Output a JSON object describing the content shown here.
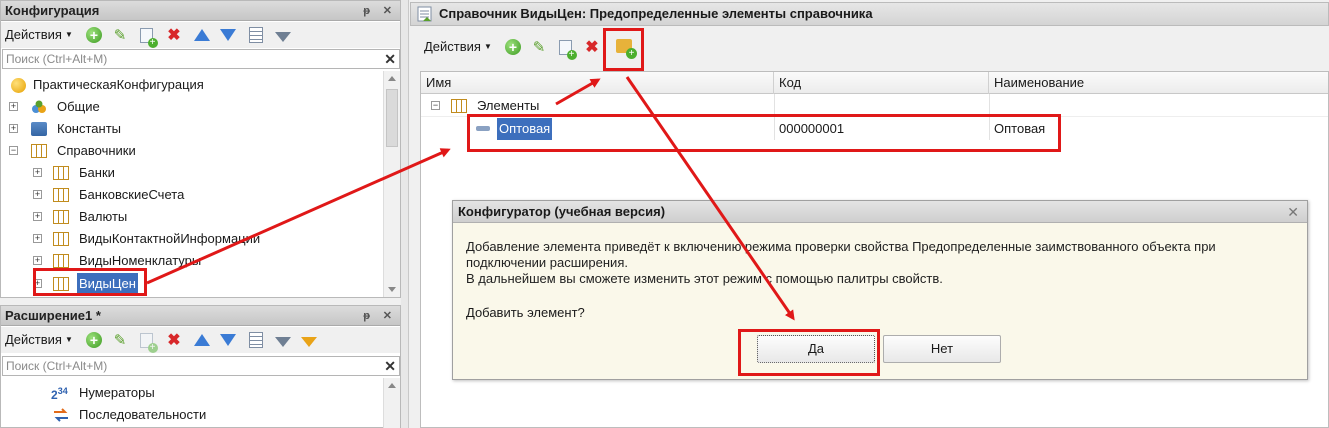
{
  "config_panel": {
    "title": "Конфигурация",
    "pin": "ᵽ",
    "close": "✕",
    "actions_label": "Действия",
    "search_placeholder": "Поиск (Ctrl+Alt+M)",
    "search_clear": "✕",
    "tree": [
      {
        "label": "ПрактическаяКонфигурация",
        "icon": "configuration-icon"
      },
      {
        "label": "Общие",
        "icon": "common-icon",
        "expander": "+"
      },
      {
        "label": "Константы",
        "icon": "constants-icon",
        "expander": "+"
      },
      {
        "label": "Справочники",
        "icon": "catalog-icon",
        "expander": "−"
      },
      {
        "label": "Банки",
        "icon": "catalog-icon",
        "expander": "+"
      },
      {
        "label": "БанковскиеСчета",
        "icon": "catalog-icon",
        "expander": "+"
      },
      {
        "label": "Валюты",
        "icon": "catalog-icon",
        "expander": "+"
      },
      {
        "label": "ВидыКонтактнойИнформации",
        "icon": "catalog-icon",
        "expander": "+"
      },
      {
        "label": "ВидыНоменклатуры",
        "icon": "catalog-icon",
        "expander": "+"
      },
      {
        "label": "ВидыЦен",
        "icon": "catalog-icon",
        "expander": "+",
        "selected": true
      }
    ]
  },
  "extension_panel": {
    "title": "Расширение1 *",
    "pin": "ᵽ",
    "close": "✕",
    "actions_label": "Действия",
    "search_placeholder": "Поиск (Ctrl+Alt+M)",
    "search_clear": "✕",
    "tree": [
      {
        "label": "Нумераторы",
        "icon": "numerators-icon"
      },
      {
        "label": "Последовательности",
        "icon": "sequences-icon"
      }
    ]
  },
  "catalog_window": {
    "title": "Справочник ВидыЦен: Предопределенные элементы справочника",
    "actions_label": "Действия",
    "columns": [
      "Имя",
      "Код",
      "Наименование"
    ],
    "group_row": {
      "label": "Элементы",
      "expander": "−"
    },
    "element_row": {
      "name": "Оптовая",
      "code": "000000001",
      "description": "Оптовая"
    }
  },
  "dialog": {
    "title": "Конфигуратор (учебная версия)",
    "close": "✕",
    "message_line1": "Добавление элемента приведёт к включению режима проверки свойства Предопределенные заимствованного объекта при",
    "message_line2": "подключении расширения.",
    "message_line3": "В дальнейшем вы сможете изменить этот режим с помощью палитры свойств.",
    "question": "Добавить элемент?",
    "yes": "Да",
    "no": "Нет"
  },
  "colors": {
    "accent_red": "#e01818",
    "selection_blue": "#3d6fbd",
    "dialog_bg": "#faf8ea"
  }
}
